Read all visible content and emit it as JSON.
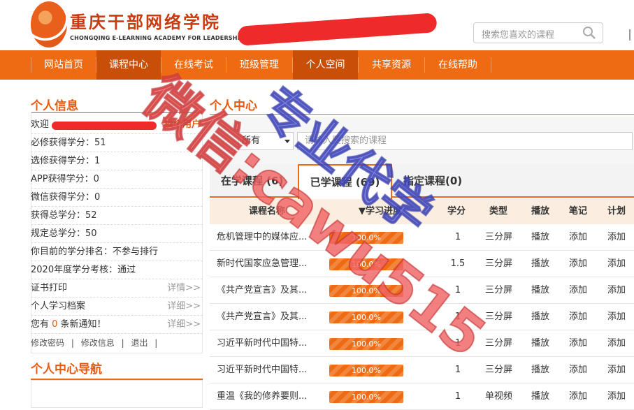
{
  "header": {
    "logo_cn": "重庆干部网络学院",
    "logo_en": "CHONGQING E-LEARNING ACADEMY FOR LEADERSHIP",
    "search_placeholder": "搜索您喜欢的课程"
  },
  "nav": {
    "items": [
      {
        "label": "网站首页"
      },
      {
        "label": "课程中心"
      },
      {
        "label": "在线考试"
      },
      {
        "label": "班级管理"
      },
      {
        "label": "个人空间"
      },
      {
        "label": "共享资源"
      },
      {
        "label": "在线帮助"
      }
    ]
  },
  "left": {
    "title": "个人信息",
    "welcome": "欢迎",
    "switch_user": "换个用户",
    "rows": [
      "必修获得学分：51",
      "选修获得学分：1",
      "APP获得学分：0",
      "微信获得学分：0",
      "获得总学分：52",
      "规定总学分：50",
      "你目前的学分排名：不参与排行",
      "2020年度学分考核：通过"
    ],
    "cert_print": "证书打印",
    "learning_archive": "个人学习档案",
    "notice_prefix": "您有 ",
    "notice_count": "0",
    "notice_suffix": " 条新通知！",
    "detail_label": "详情>>",
    "detail_label2": "详细>>",
    "links": {
      "change_password": "修改密码",
      "edit_info": "修改信息",
      "logout": "退出",
      "sep": "|"
    },
    "nav_title": "个人中心导航"
  },
  "right": {
    "title": "个人中心",
    "filter_select": "所有",
    "search_placeholder": "请输入要搜索的课程",
    "tabs": [
      {
        "label": "在学课程 (6)"
      },
      {
        "label": "已学课程 (69)"
      },
      {
        "label": "指定课程(0)"
      }
    ],
    "headers": {
      "name": "课程名称",
      "progress": "▼学习进度",
      "credit": "学分",
      "type": "类型",
      "play": "播放",
      "notes": "笔记",
      "plan": "计划"
    },
    "courses": [
      {
        "name": "危机管理中的媒体应...",
        "progress": "100.0%",
        "progress_value": 1.0,
        "credit": "1",
        "type": "三分屏",
        "play": "播放",
        "notes": "添加",
        "plan": "添加"
      },
      {
        "name": "新时代国家应急管理...",
        "progress": "100.0%",
        "progress_value": 1.0,
        "credit": "1.5",
        "type": "三分屏",
        "play": "播放",
        "notes": "添加",
        "plan": "添加"
      },
      {
        "name": "《共产党宣言》及其...",
        "progress": "100.0%",
        "progress_value": 1.0,
        "credit": "1",
        "type": "三分屏",
        "play": "播放",
        "notes": "添加",
        "plan": "添加"
      },
      {
        "name": "《共产党宣言》及其...",
        "progress": "100.0%",
        "progress_value": 1.0,
        "credit": "1",
        "type": "三分屏",
        "play": "播放",
        "notes": "添加",
        "plan": "添加"
      },
      {
        "name": "习近平新时代中国特...",
        "progress": "100.0%",
        "progress_value": 1.0,
        "credit": "1",
        "type": "三分屏",
        "play": "播放",
        "notes": "添加",
        "plan": "添加"
      },
      {
        "name": "习近平新时代中国特...",
        "progress": "100.0%",
        "progress_value": 1.0,
        "credit": "1",
        "type": "三分屏",
        "play": "播放",
        "notes": "添加",
        "plan": "添加"
      },
      {
        "name": "重温《我的修养要则...",
        "progress": "100.0%",
        "progress_value": 1.0,
        "credit": "1",
        "type": "单视频",
        "play": "播放",
        "notes": "添加",
        "plan": "添加"
      }
    ]
  },
  "watermark": {
    "text": "微信:cawu515",
    "text2": "专业代学",
    "color": "#f06060"
  },
  "colors": {
    "accent": "#ee6b14",
    "nav_active": "#c94e08",
    "title": "#e35a12"
  }
}
